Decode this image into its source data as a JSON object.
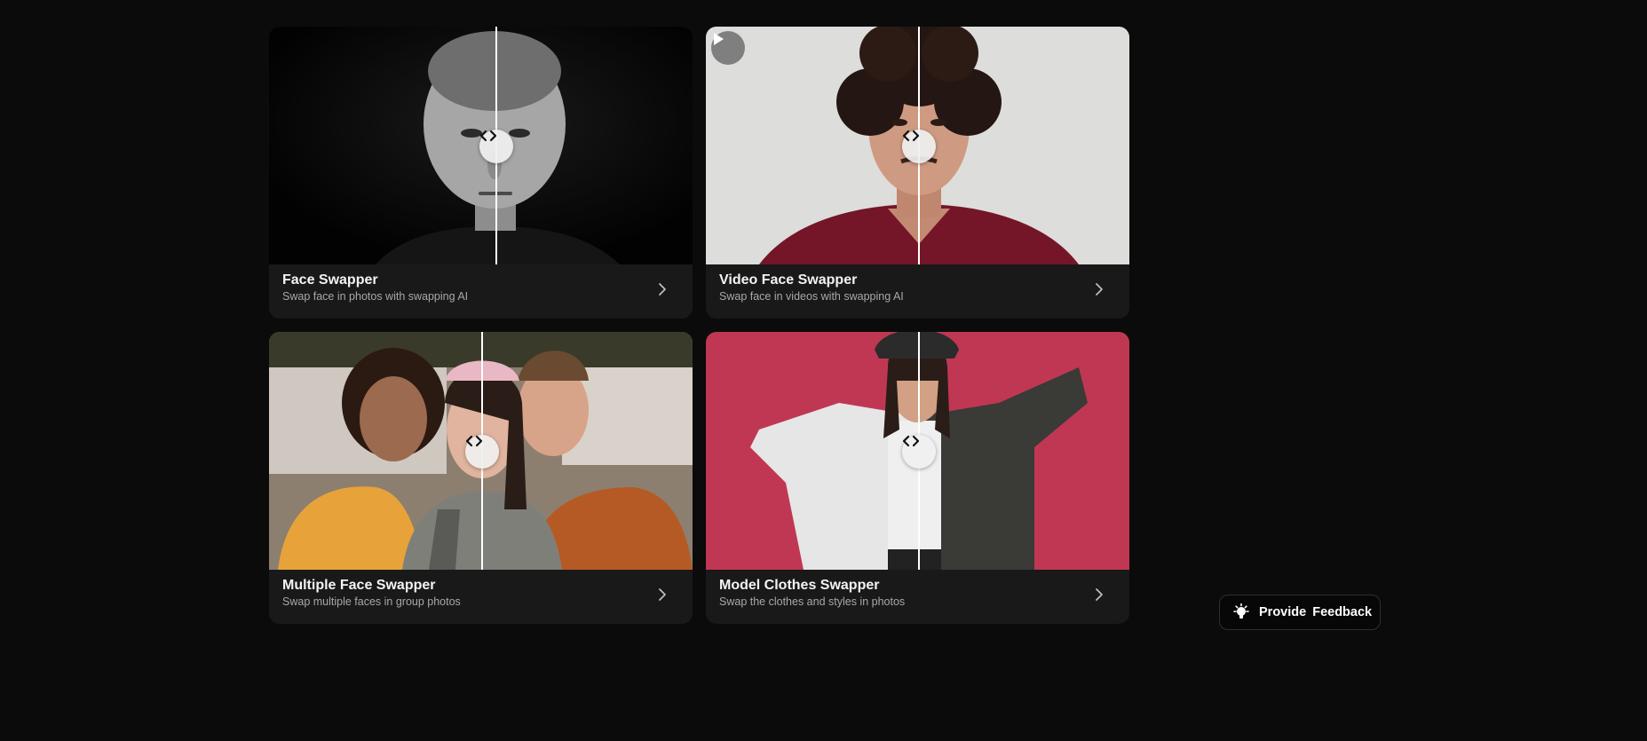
{
  "cards": [
    {
      "title": "Face Swapper",
      "subtitle": "Swap face in photos with swapping AI",
      "has_video_badge": false,
      "compare_position": 0.536,
      "colors": {
        "background": "#050505",
        "accent": "#d9d9d9"
      }
    },
    {
      "title": "Video Face Swapper",
      "subtitle": "Swap face in videos with swapping AI",
      "has_video_badge": true,
      "compare_position": 0.503,
      "colors": {
        "background": "#e4e3e1",
        "accent": "#7a1526"
      }
    },
    {
      "title": "Multiple Face Swapper",
      "subtitle": "Swap multiple faces in group photos",
      "has_video_badge": false,
      "compare_position": 0.503,
      "colors": {
        "background": "#9b8f80",
        "accent": "#b85a24"
      }
    },
    {
      "title": "Model Clothes Swapper",
      "subtitle": "Swap the clothes and styles in photos",
      "has_video_badge": false,
      "compare_position": 0.503,
      "colors": {
        "background": "#c23a55",
        "accent": "#3a3a36"
      }
    }
  ],
  "icons": {
    "compare_handle": "compare-arrows-icon",
    "card_link": "chevron-right-icon",
    "video_badge": "play-icon",
    "feedback": "lightbulb-icon"
  },
  "feedback": {
    "label": "Provide Feedback"
  }
}
